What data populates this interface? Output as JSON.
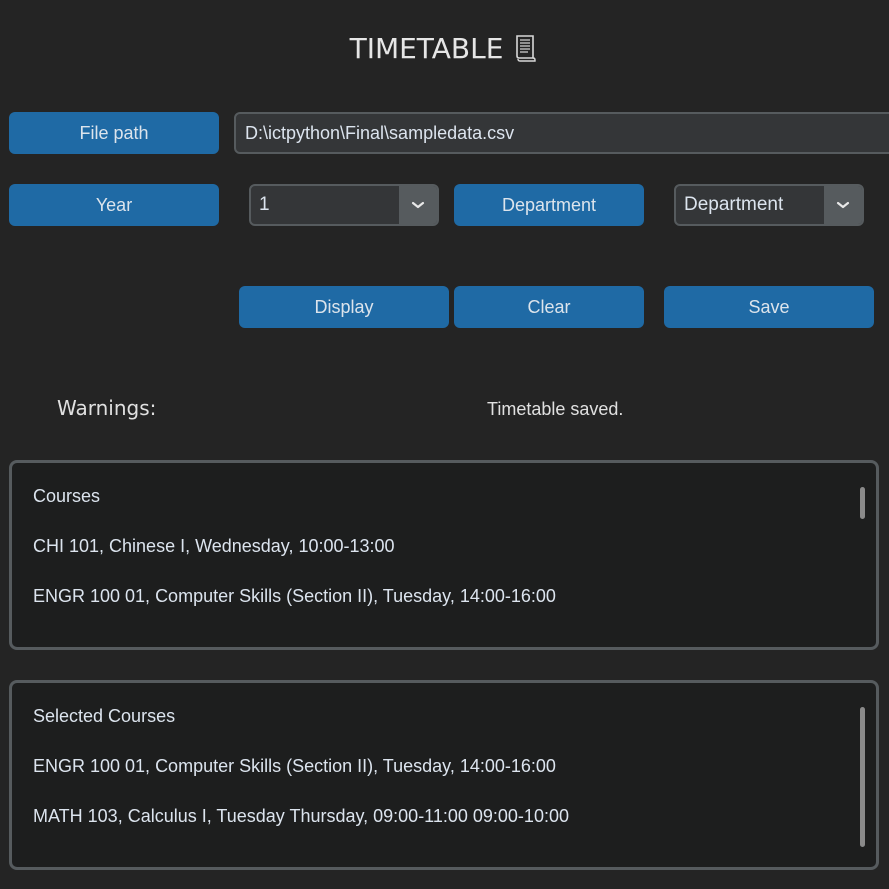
{
  "title": {
    "text": "TIMETABLE",
    "icon": "document-icon"
  },
  "file_path": {
    "button_label": "File path",
    "value": "D:\\ictpython\\Final\\sampledata.csv"
  },
  "year": {
    "button_label": "Year",
    "selected": "1"
  },
  "department": {
    "button_label": "Department",
    "selected": "Department"
  },
  "actions": {
    "display_label": "Display",
    "clear_label": "Clear",
    "save_label": "Save"
  },
  "warnings": {
    "label": "Warnings:",
    "message": "Timetable saved."
  },
  "courses_box": {
    "lines": [
      "Courses",
      "CHI 101, Chinese I, Wednesday, 10:00-13:00",
      "ENGR 100 01, Computer Skills (Section II), Tuesday, 14:00-16:00"
    ]
  },
  "selected_box": {
    "lines": [
      "Selected Courses",
      "ENGR 100 01, Computer Skills (Section II), Tuesday, 14:00-16:00",
      "MATH 103, Calculus I, Tuesday Thursday, 09:00-11:00 09:00-10:00"
    ]
  },
  "colors": {
    "background": "#242424",
    "button": "#1f6aa5",
    "border": "#565b5e",
    "field": "#343638"
  }
}
